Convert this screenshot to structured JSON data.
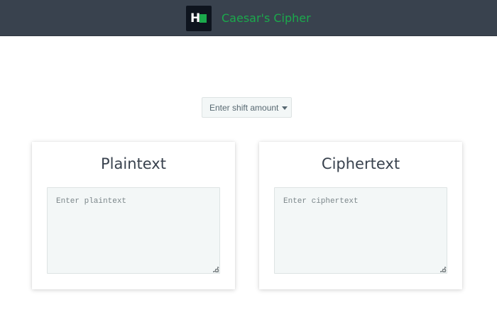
{
  "header": {
    "logo_letter": "H",
    "title": "Caesar's Cipher",
    "accent_color": "#1ba94c",
    "background_color": "#39424e"
  },
  "shift": {
    "selected_label": "Enter shift amount",
    "icon": "chevron-down-icon"
  },
  "panels": {
    "plaintext": {
      "title": "Plaintext",
      "placeholder": "Enter plaintext",
      "value": ""
    },
    "ciphertext": {
      "title": "Ciphertext",
      "placeholder": "Enter ciphertext",
      "value": ""
    }
  }
}
